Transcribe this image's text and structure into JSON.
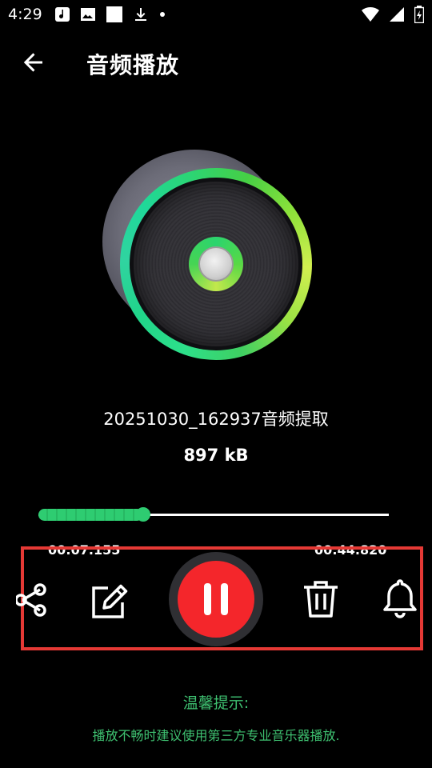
{
  "status_bar": {
    "time": "4:29",
    "icons_left": [
      "music-note-icon",
      "image-icon",
      "square-icon",
      "download-icon",
      "dot-icon"
    ],
    "icons_right": [
      "wifi-icon",
      "signal-icon",
      "battery-icon"
    ]
  },
  "app_bar": {
    "title": "音频播放",
    "back_icon": "arrow-left-icon"
  },
  "player": {
    "file_name": "20251030_162937音频提取",
    "file_size": "897 kB",
    "progress": 0.3,
    "current_time": "00:07.155",
    "total_time": "00:44.820",
    "is_playing": true
  },
  "controls": {
    "share_icon": "share-icon",
    "edit_icon": "edit-icon",
    "pause_icon": "pause-icon",
    "delete_icon": "trash-icon",
    "ringtone_icon": "bell-icon"
  },
  "tip": {
    "title": "温馨提示:",
    "body": "播放不畅时建议使用第三方专业音乐器播放."
  },
  "colors": {
    "background": "#000000",
    "accent_green": "#2ecc71",
    "play_button": "#f4262b",
    "highlight_border": "#e53935",
    "tip_text": "#3ec070"
  }
}
